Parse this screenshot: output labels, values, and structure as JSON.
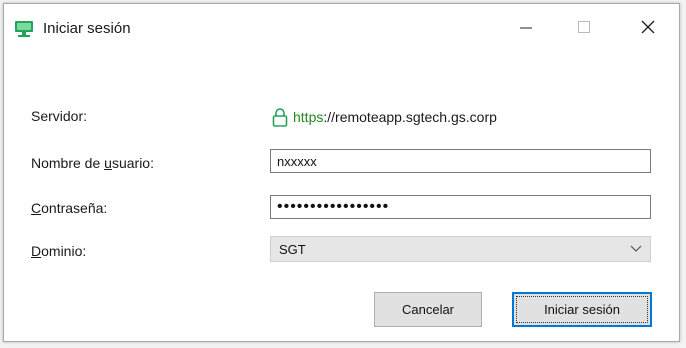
{
  "window": {
    "title": "Iniciar sesión",
    "controls": {
      "minimize": "minimize-icon",
      "maximize": "maximize-icon",
      "close": "close-icon"
    }
  },
  "form": {
    "server": {
      "label": "Servidor:",
      "scheme": "https",
      "rest": "://remoteapp.sgtech.gs.corp",
      "icon": "lock-icon"
    },
    "username": {
      "label_pre": "Nombre de ",
      "label_u": "u",
      "label_post": "suario:",
      "value": "nxxxxx"
    },
    "password": {
      "label_u": "C",
      "label_post": "ontraseña:",
      "value": "•••••••••••••••••"
    },
    "domain": {
      "label_u": "D",
      "label_post": "ominio:",
      "value": "SGT"
    }
  },
  "buttons": {
    "cancel": "Cancelar",
    "signin": "Iniciar sesión"
  },
  "colors": {
    "https": "#1f8a1f",
    "focus": "#0078d7",
    "icon": "#22a35a"
  }
}
